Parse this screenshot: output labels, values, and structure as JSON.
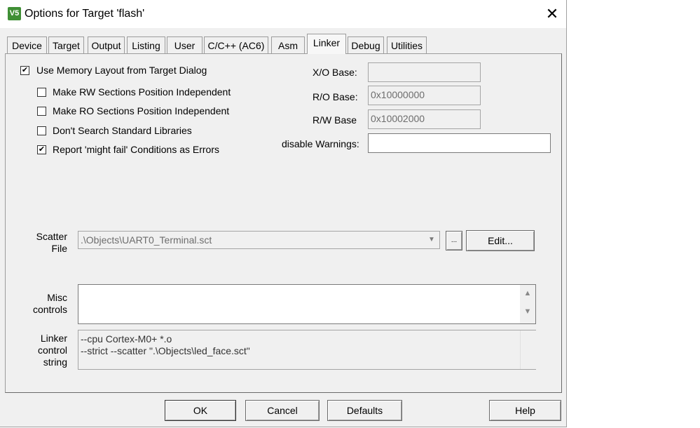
{
  "window": {
    "title": "Options for Target 'flash'",
    "close": "✕",
    "app_icon": "keil-uvision-icon"
  },
  "tabs": [
    {
      "label": "Device"
    },
    {
      "label": "Target"
    },
    {
      "label": "Output"
    },
    {
      "label": "Listing"
    },
    {
      "label": "User"
    },
    {
      "label": "C/C++ (AC6)"
    },
    {
      "label": "Asm"
    },
    {
      "label": "Linker",
      "active": true
    },
    {
      "label": "Debug"
    },
    {
      "label": "Utilities"
    }
  ],
  "options": {
    "use_memory_layout": {
      "label": "Use Memory Layout from Target Dialog",
      "checked": true
    },
    "rw_independent": {
      "label": "Make RW Sections Position Independent",
      "checked": false
    },
    "ro_independent": {
      "label": "Make RO Sections Position Independent",
      "checked": false
    },
    "no_std_libs": {
      "label": "Don't Search Standard Libraries",
      "checked": false
    },
    "might_fail_errors": {
      "label": "Report 'might fail' Conditions as Errors",
      "checked": true
    }
  },
  "bases": {
    "xo_label": "X/O Base:",
    "xo_value": "",
    "ro_label": "R/O Base:",
    "ro_value": "0x10000000",
    "rw_label": "R/W Base",
    "rw_value": "0x10002000",
    "warn_label": "disable Warnings:",
    "warn_value": ""
  },
  "scatter": {
    "label_line1": "Scatter",
    "label_line2": "File",
    "value": ".\\Objects\\UART0_Terminal.sct",
    "browse": "...",
    "edit": "Edit..."
  },
  "misc": {
    "label_line1": "Misc",
    "label_line2": "controls",
    "value": ""
  },
  "linker_string": {
    "label_line1": "Linker",
    "label_line2": "control",
    "label_line3": "string",
    "line1": "--cpu Cortex-M0+ *.o",
    "line2": "--strict --scatter \".\\Objects\\led_face.sct\""
  },
  "buttons": {
    "ok": "OK",
    "cancel": "Cancel",
    "defaults": "Defaults",
    "help": "Help"
  }
}
